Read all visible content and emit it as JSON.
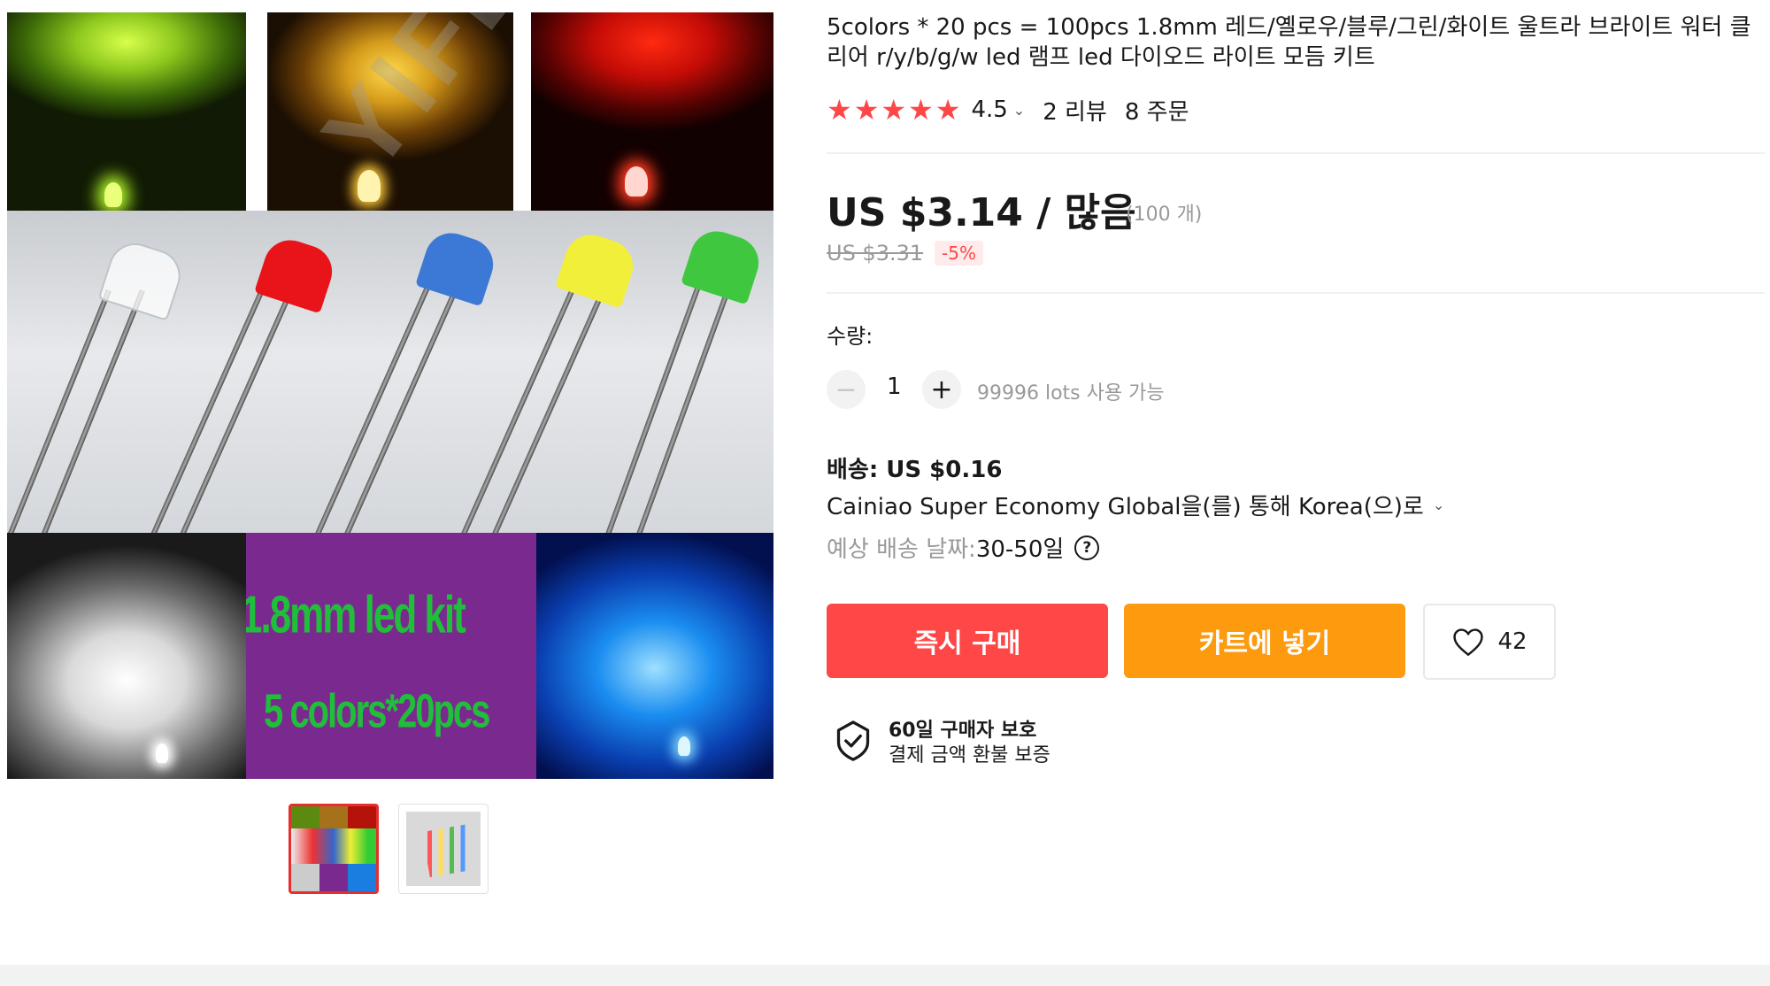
{
  "product": {
    "title": "5colors * 20 pcs = 100pcs 1.8mm 레드/옐로우/블루/그린/화이트 울트라 브라이트 워터 클리어 r/y/b/g/w led 램프 led 다이오드 라이트 모듬 키트",
    "rating": "4.5",
    "reviews": "2 리뷰",
    "orders": "8 주문"
  },
  "gallery": {
    "watermark": "YIFENG",
    "kit_line1": "1.8mm led kit",
    "kit_line2": "5 colors*20pcs"
  },
  "price": {
    "current": "US $3.14 / 많음",
    "unit": "(100 개)",
    "original": "US $3.31",
    "discount": "-5%"
  },
  "quantity": {
    "label": "수량:",
    "value": "1",
    "available": "99996 lots 사용 가능"
  },
  "shipping": {
    "title": "배송: US $0.16",
    "method": "Cainiao Super Economy Global을(를) 통해 Korea(으)로",
    "eta_label": "예상 배송 날짜: ",
    "eta_value": "30-50일"
  },
  "actions": {
    "buy_now": "즉시 구매",
    "add_to_cart": "카트에 넣기",
    "wishlist_count": "42"
  },
  "protection": {
    "title": "60일 구매자 보호",
    "subtitle": "결제 금액 환불 보증"
  },
  "colors": {
    "accent_red": "#ff4747",
    "cart_orange": "#fd9a0e"
  }
}
